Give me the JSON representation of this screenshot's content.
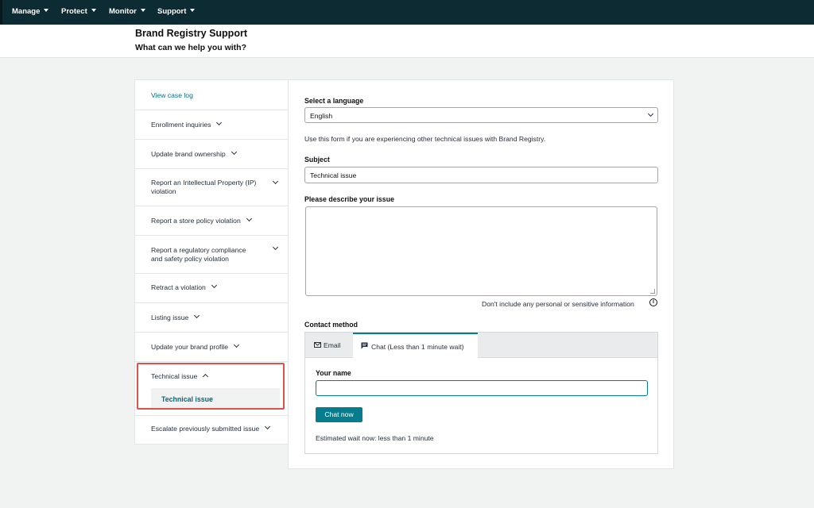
{
  "topnav": {
    "items": [
      {
        "label": "Manage"
      },
      {
        "label": "Protect"
      },
      {
        "label": "Monitor"
      },
      {
        "label": "Support"
      }
    ]
  },
  "header": {
    "title": "Brand Registry Support",
    "subtitle": "What can we help you with?"
  },
  "sidebar": {
    "view_case_log": "View case log",
    "items": [
      {
        "label": "Enrollment inquiries"
      },
      {
        "label": "Update brand ownership"
      },
      {
        "label_line1": "Report an Intellectual Property (IP)",
        "label_line2": "violation"
      },
      {
        "label": "Report a store policy violation"
      },
      {
        "label_line1": "Report a regulatory compliance",
        "label_line2": "and safety policy violation"
      },
      {
        "label": "Retract a violation"
      },
      {
        "label": "Listing issue"
      },
      {
        "label": "Update your brand profile"
      },
      {
        "label": "Technical issue",
        "expanded": true,
        "sub_items": [
          {
            "label": "Technical issue"
          }
        ]
      },
      {
        "label": "Escalate previously submitted issue"
      }
    ]
  },
  "form": {
    "language_label": "Select a language",
    "language_value": "English",
    "info_text": "Use this form if you are experiencing other technical issues with Brand Registry.",
    "subject_label": "Subject",
    "subject_value": "Technical issue",
    "describe_label": "Please describe your issue",
    "describe_value": "",
    "privacy_note": "Don't include any personal or sensitive information",
    "contact_label": "Contact method",
    "tabs": [
      {
        "label": "Email",
        "icon": "envelope-icon"
      },
      {
        "label": "Chat (Less than 1 minute wait)",
        "icon": "chat-bubble-icon",
        "active": true
      }
    ],
    "name_label": "Your name",
    "name_value": "",
    "chat_button": "Chat now",
    "wait_text": "Estimated wait now: less than 1 minute"
  },
  "colors": {
    "topbar": "#0d2b33",
    "accent": "#067d8e",
    "link": "#007185",
    "highlight_border": "#d9534f"
  }
}
